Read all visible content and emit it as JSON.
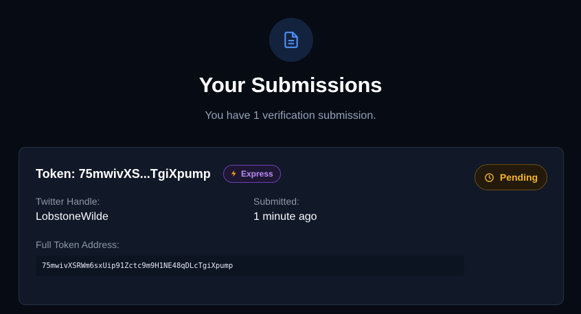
{
  "header": {
    "title": "Your Submissions",
    "subtitle": "You have 1 verification submission.",
    "icon": "document-icon"
  },
  "submission": {
    "title": "Token: 75mwivXS...TgiXpump",
    "tier_badge": {
      "label": "Express",
      "icon": "lightning-icon"
    },
    "status_badge": {
      "label": "Pending",
      "icon": "clock-icon"
    },
    "twitter_label": "Twitter Handle:",
    "twitter_value": "LobstoneWilde",
    "submitted_label": "Submitted:",
    "submitted_value": "1 minute ago",
    "address_label": "Full Token Address:",
    "address_value": "75mwivXSRWm6sxUip91Zctc9m9H1NE48qDLcTgiXpump"
  },
  "colors": {
    "background": "#070b14",
    "card": "#111827",
    "accent_blue": "#3b82f6",
    "express_purple": "#b78cf5",
    "pending_amber": "#f5b52a"
  }
}
